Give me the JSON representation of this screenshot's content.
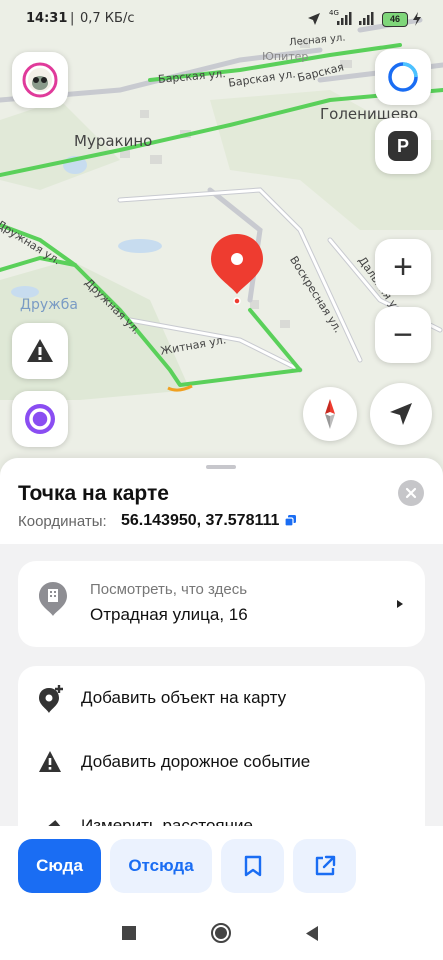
{
  "status_bar": {
    "time": "14:31",
    "speed": "0,7 КБ/с",
    "network": "4G",
    "battery": "46"
  },
  "map": {
    "labels": {
      "murakino": "Муракино",
      "golenishchevo": "Голенищево",
      "druzhba": "Дружба",
      "yupiter": "Юпитер",
      "lesnaya": "Лесная ул.",
      "barskaya1": "Барская ул.",
      "barskaya2": "Барская ул.",
      "barskaya3": "Барская",
      "druzhnaya1": "Дружная ул.",
      "druzhnaya2": "Дружная ул.",
      "zhitnaya": "Житная ул.",
      "voskresnaya": "Воскресная ул.",
      "dalnyaya": "Дальняя ул."
    },
    "controls": {
      "zoom_in": "+",
      "zoom_out": "−",
      "parking": "P"
    }
  },
  "sheet": {
    "title": "Точка на карте",
    "coords_label": "Координаты:",
    "coords_value": "56.143950, 37.578111",
    "whats_here_caption": "Посмотреть, что здесь",
    "whats_here_address": "Отрадная улица, 16",
    "actions": {
      "add_object": "Добавить объект на карту",
      "add_event": "Добавить дорожное событие",
      "measure": "Измерить расстояние"
    }
  },
  "buttons": {
    "here": "Сюда",
    "from_here": "Отсюда"
  },
  "colors": {
    "accent": "#1a6df3",
    "pin": "#ee3c30",
    "road_green": "#5ad05a",
    "map_bg": "#ecefe6"
  }
}
